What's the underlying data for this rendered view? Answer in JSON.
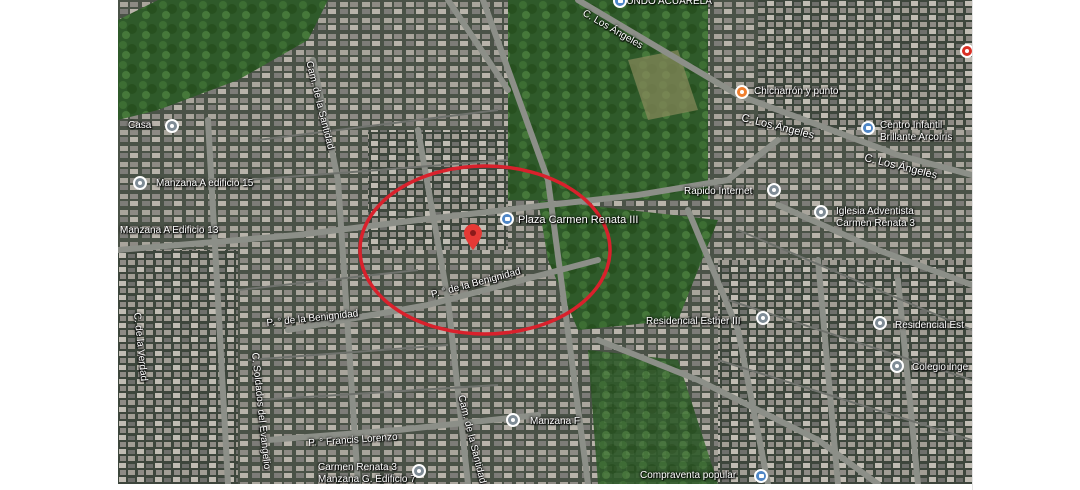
{
  "map": {
    "view": "satellite",
    "highlight_color": "#d9212c",
    "selected_pin_color": "#e53935",
    "roads": [
      {
        "id": "c-los-angeles",
        "label": "C. Los Ángeles"
      },
      {
        "id": "p-de-la-benignidad",
        "label": "P. ° de la Benignidad"
      },
      {
        "id": "cam-de-la-santidad",
        "label": "Cam. de la Santidad"
      },
      {
        "id": "c-soldados-del-evangelio",
        "label": "C. Soldados del Evangelio"
      },
      {
        "id": "c-de-la-verdad",
        "label": "C. de la Verdad"
      },
      {
        "id": "p-francis-lorenzo",
        "label": "P. ° Francis Lorenzo"
      }
    ],
    "labels": {
      "mundo_acuarela": "MUNDO ACUARELA",
      "c_los_angeles_top": "C. Los Ángeles",
      "c_los_angeles_mid": "C. Los Ángeles",
      "c_los_angeles_right": "C. Los Ángeles",
      "cam_santidad_top": "Cam. de la Santidad",
      "cam_santidad_bottom": "Cam. de la Santidad",
      "chicharron": "Chicharrón y punto",
      "centro_infantil_1": "Centro Infantil",
      "centro_infantil_2": "Brillante Arcoíris",
      "casa": "Casa",
      "manzana_a_15": "Manzana A edificio 15",
      "manzana_a_13": "Manzana A Edificio 13",
      "rapido_internet": "Rapido Internet",
      "plaza_carmen": "Plaza Carmen Renata III",
      "iglesia_1": "Iglesia Adventista",
      "iglesia_2": "Carmen Renata 3",
      "benignidad_1": "P. ° de la Benignidad",
      "benignidad_2": "P. ° de la Benignidad",
      "residencial_esther": "Residencial Esther III",
      "residencial_est": "Residencial Est",
      "c_de_la_verdad": "C. de la Verdad",
      "soldados": "C. Soldados del Evangelio",
      "colegio": "Colegio Inge",
      "manzana_f": "Manzana F",
      "francis": "P. ° Francis Lorenzo",
      "carmen_renata_3": "Carmen Renata 3",
      "manzana_g": "Manzana G. Edificio 7",
      "compraventa": "Compraventa popular"
    },
    "icons": {
      "store": "store-pin-icon",
      "restaurant": "restaurant-pin-icon",
      "school": "school-pin-icon",
      "place": "place-pin-icon",
      "church": "church-pin-icon",
      "selected": "location-marker-icon"
    }
  }
}
